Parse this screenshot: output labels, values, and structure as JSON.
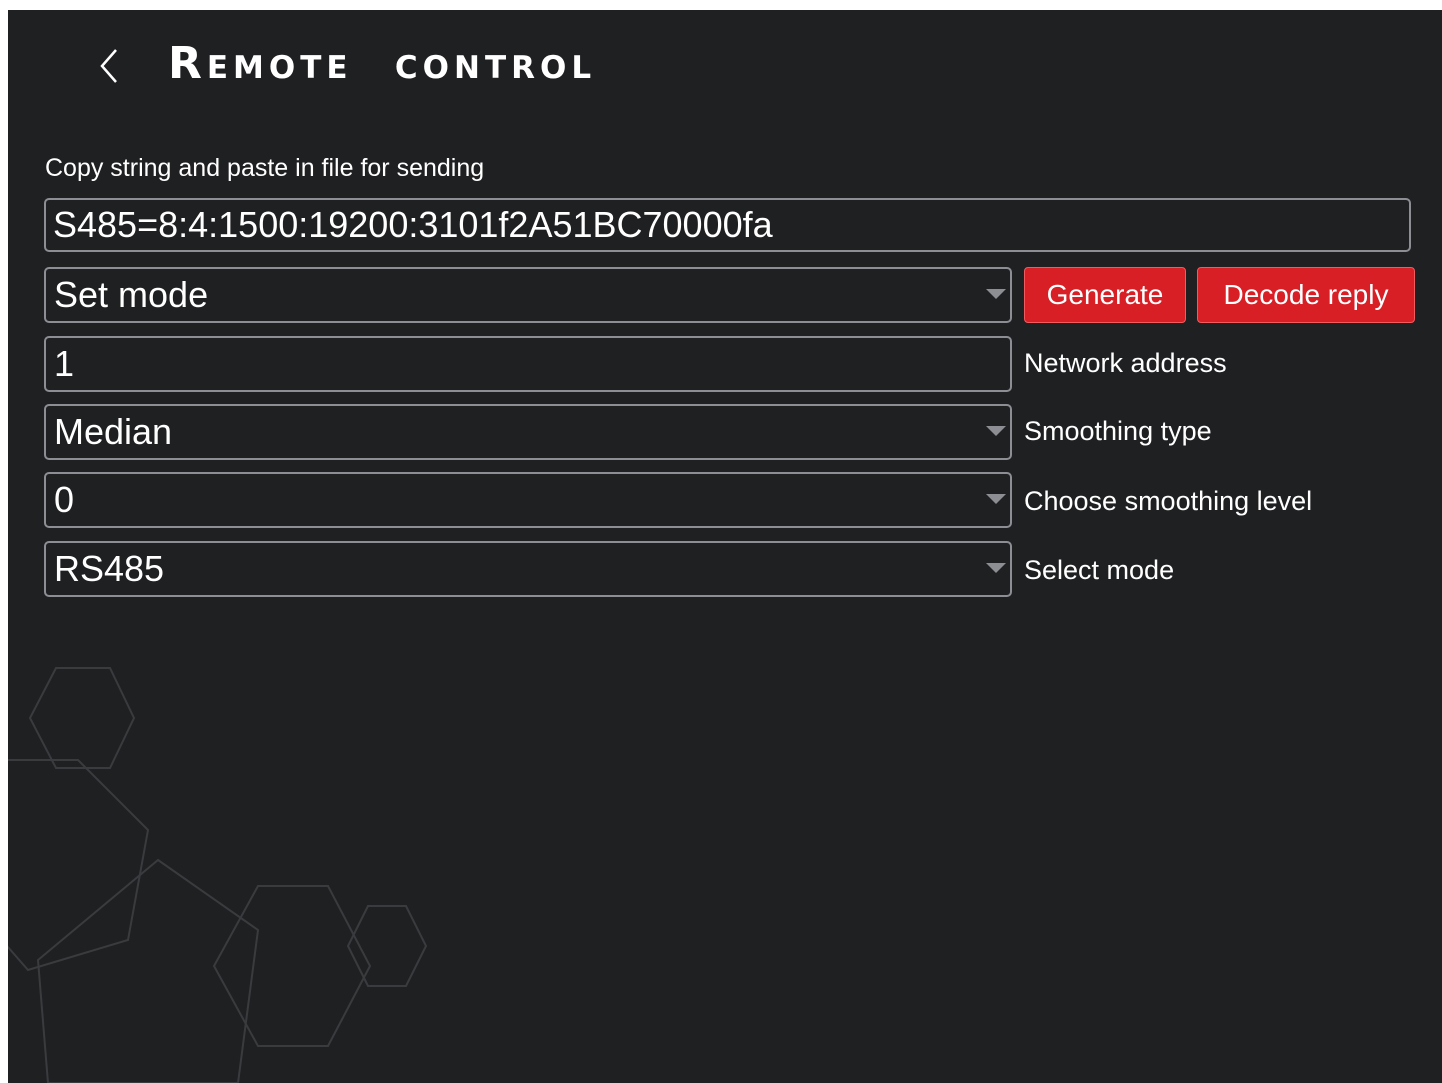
{
  "colors": {
    "background": "#1f2022",
    "field_border": "#8c8e93",
    "accent": "#d81f26",
    "text": "#ffffff",
    "decoration_lines": "#3a3b3e"
  },
  "header": {
    "back_icon": "chevron-left-icon",
    "title": "Remote control"
  },
  "form": {
    "copy_label": "Copy string and paste in file for sending",
    "generated_string": "S485=8:4:1500:19200:3101f2A51BC70000fa",
    "command_select": {
      "value": "Set mode"
    },
    "generate_label": "Generate",
    "decode_label": "Decode reply",
    "network_address": {
      "value": "1",
      "label": "Network address"
    },
    "smoothing_type": {
      "value": "Median",
      "label": "Smoothing type"
    },
    "smoothing_level": {
      "value": "0",
      "label": "Choose smoothing level"
    },
    "mode": {
      "value": "RS485",
      "label": "Select mode"
    }
  },
  "decoration": {
    "icon": "hexagon-pattern"
  }
}
